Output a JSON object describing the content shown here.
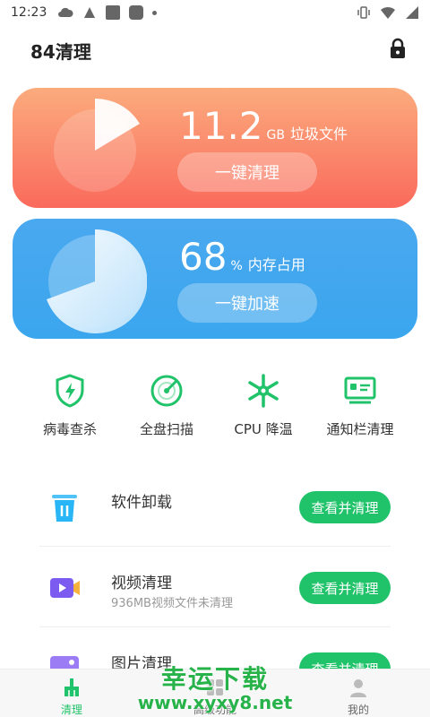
{
  "status_bar": {
    "time": "12:23"
  },
  "header": {
    "title": "84清理",
    "lock_icon": "lock-icon"
  },
  "junk_card": {
    "value": "11.2",
    "unit": "GB",
    "label": "垃圾文件",
    "button": "一键清理",
    "colors": {
      "top": "#fbab7d",
      "bottom": "#fa6a5c"
    }
  },
  "memory_card": {
    "value": "68",
    "unit": "%",
    "label": "内存占用",
    "button": "一键加速",
    "usage_fraction": 0.68,
    "colors": {
      "top": "#4aa8ef",
      "bottom": "#3aa6ee"
    }
  },
  "tools": [
    {
      "label": "病毒查杀",
      "icon": "shield-bolt-icon"
    },
    {
      "label": "全盘扫描",
      "icon": "radar-icon"
    },
    {
      "label": "CPU 降温",
      "icon": "snowflake-icon"
    },
    {
      "label": "通知栏清理",
      "icon": "notification-card-icon"
    }
  ],
  "list": [
    {
      "title": "软件卸载",
      "subtitle": "",
      "button": "查看并清理",
      "icon": "trash-bin-icon"
    },
    {
      "title": "视频清理",
      "subtitle": "936MB视频文件未清理",
      "button": "查看并清理",
      "icon": "video-camera-icon"
    },
    {
      "title": "图片清理",
      "subtitle": "",
      "button": "查看并清理",
      "icon": "image-icon"
    }
  ],
  "bottom_nav": [
    {
      "label": "清理",
      "icon": "broom-icon",
      "active": true
    },
    {
      "label": "高级功能",
      "icon": "grid-icon",
      "active": false
    },
    {
      "label": "我的",
      "icon": "person-icon",
      "active": false
    }
  ],
  "watermark": {
    "cn": "幸运下载",
    "url": "www.xyxy8.net"
  },
  "accent_color": "#21c36a"
}
